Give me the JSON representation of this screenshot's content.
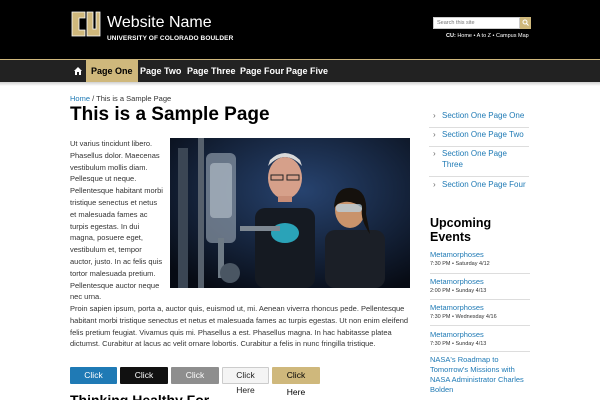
{
  "header": {
    "site_name": "Website Name",
    "university": "UNIVERSITY OF COLORADO BOULDER",
    "search_placeholder": "Search this site",
    "top_links_prefix": "CU:",
    "top_links": "Home • A to Z • Campus Map"
  },
  "nav": {
    "items": [
      {
        "label": "Page One",
        "active": true
      },
      {
        "label": "Page Two"
      },
      {
        "label": "Page Three"
      },
      {
        "label": "Page Four"
      },
      {
        "label": "Page Five"
      }
    ]
  },
  "breadcrumb": {
    "home": "Home",
    "separator": " / ",
    "current": "This is a Sample Page"
  },
  "page": {
    "title": "This is a Sample Page",
    "intro_text": "Ut varius tincidunt libero. Phasellus dolor. Maecenas vestibulum mollis diam. Pellesque ut neque. Pellentesque habitant morbi tristique senectus et netus et malesuada fames ac turpis egestas. In dui magna, posuere eget, vestibulum et, tempor auctor, justo. In ac felis quis tortor malesuada pretium. Pellentesque auctor neque nec urna.",
    "wide_text": "Proin sapien ipsum, porta a, auctor quis, euismod ut, mi. Aenean viverra rhoncus pede. Pellentesque habitant morbi tristique senectus et netus et malesuada fames ac turpis egestas. Ut non enim eleifend felis pretium feugiat. Vivamus quis mi. Phasellus a est. Phasellus magna. In hac habitasse platea dictumst. Curabitur at lacus ac velit ornare lobortis. Curabitur a felis in nunc fringilla tristique.",
    "buttons": [
      "Click Here",
      "Click Here",
      "Click Here",
      "Click Here",
      "Click Here"
    ],
    "next_heading": "Thinking Healthy For"
  },
  "sidebar": {
    "section_links": [
      "Section One Page One",
      "Section One Page Two",
      "Section One Page Three",
      "Section One Page Four"
    ],
    "events_title": "Upcoming Events",
    "events": [
      {
        "title": "Metamorphoses",
        "meta": "7:30 PM • Saturday 4/12"
      },
      {
        "title": "Metamorphoses",
        "meta": "2:00 PM • Sunday 4/13"
      },
      {
        "title": "Metamorphoses",
        "meta": "7:30 PM • Wednesday 4/16"
      },
      {
        "title": "Metamorphoses",
        "meta": "7:30 PM • Sunday 4/13"
      },
      {
        "title": "NASA's Roadmap to Tomorrow's Missions with NASA Administrator Charles Bolden",
        "meta": ""
      }
    ]
  },
  "colors": {
    "header_bg": "#000000",
    "nav_bg": "#222222",
    "gold": "#cfb87c",
    "link_blue": "#1f7ab5",
    "button_gray": "#8e8e8e"
  }
}
